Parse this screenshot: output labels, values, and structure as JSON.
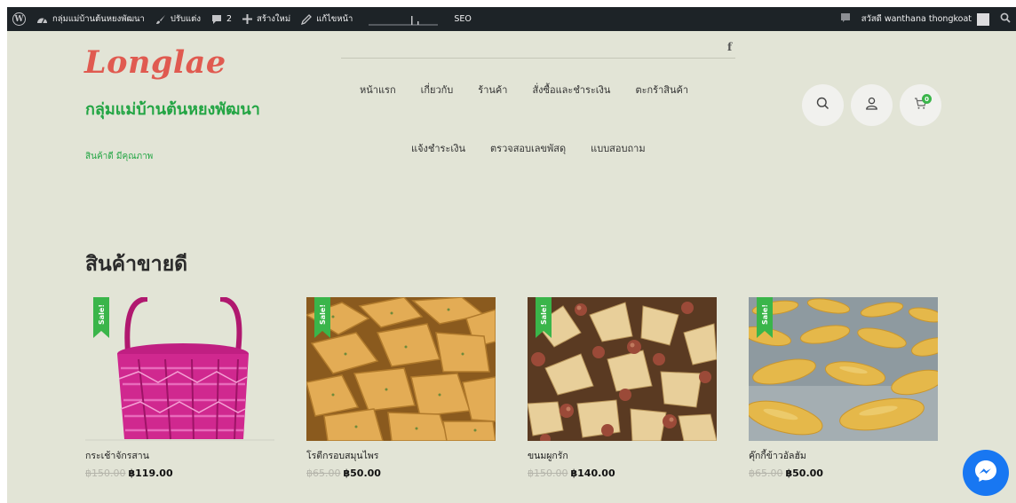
{
  "adminbar": {
    "site_name": "กลุ่มแม่บ้านต้นหยงพัฒนา",
    "customize": "ปรับแต่ง",
    "comments_count": "2",
    "new": "สร้างใหม่",
    "edit_page": "แก้ไขหน้า",
    "seo": "SEO",
    "greeting": "สวัสดี wanthana thongkoat"
  },
  "header": {
    "logo_text": "Longlae",
    "site_title": "กลุ่มแม่บ้านต้นหยงพัฒนา",
    "tagline": "สินค้าดี มีคุณภาพ",
    "facebook": "f",
    "cart_count": "0"
  },
  "menu": {
    "row1": [
      "หน้าแรก",
      "เกี่ยวกับ",
      "ร้านค้า",
      "สั่งซื้อและชำระเงิน",
      "ตะกร้าสินค้า"
    ],
    "row2": [
      "แจ้งชำระเงิน",
      "ตรวจสอบเลขพัสดุ",
      "แบบสอบถาม"
    ]
  },
  "section": {
    "title": "สินค้าขายดี"
  },
  "products": [
    {
      "name": "กระเช้าจักรสาน",
      "old_price": "฿150.00",
      "price": "฿119.00",
      "badge": "Sale!"
    },
    {
      "name": "โรตีกรอบสมุนไพร",
      "old_price": "฿65.00",
      "price": "฿50.00",
      "badge": "Sale!"
    },
    {
      "name": "ขนมผูกรัก",
      "old_price": "฿150.00",
      "price": "฿140.00",
      "badge": "Sale!"
    },
    {
      "name": "คุ๊กกี้ข้าวอัลฮัม",
      "old_price": "฿65.00",
      "price": "฿50.00",
      "badge": "Sale!"
    }
  ],
  "colors": {
    "background": "#e2e4d6",
    "brand_green": "#23a544",
    "logo_red": "#e05a50",
    "sale_green": "#3ab54a",
    "admin_bar": "#1d2327",
    "messenger": "#1877f2"
  },
  "icons": [
    "wordpress-icon",
    "dashboard-icon",
    "brush-icon",
    "comment-icon",
    "plus-icon",
    "pencil-icon",
    "search-icon",
    "user-icon",
    "cart-icon",
    "messenger-icon"
  ]
}
